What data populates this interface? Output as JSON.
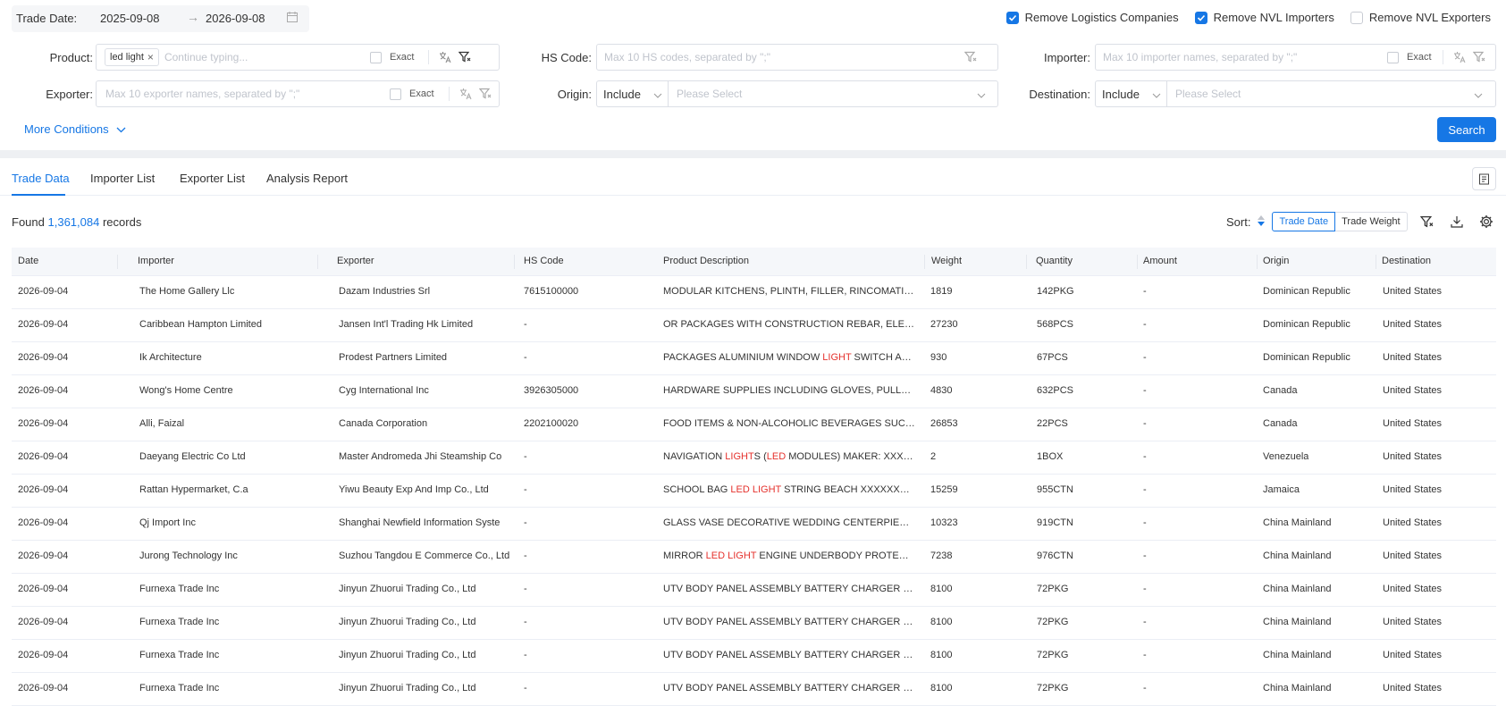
{
  "trade_date": {
    "label": "Trade Date:",
    "from": "2025-09-08",
    "arrow": "→",
    "to": "2026-09-08"
  },
  "checkboxes": [
    {
      "label": "Remove Logistics Companies",
      "checked": true
    },
    {
      "label": "Remove NVL Importers",
      "checked": true
    },
    {
      "label": "Remove NVL Exporters",
      "checked": false
    }
  ],
  "filters": {
    "product": {
      "label": "Product:",
      "tag": "led light",
      "placeholder": "Continue typing...",
      "exact": "Exact"
    },
    "hs_code": {
      "label": "HS Code:",
      "placeholder": "Max 10 HS codes, separated by \";\""
    },
    "importer": {
      "label": "Importer:",
      "placeholder": "Max 10 importer names, separated by \";\"",
      "exact": "Exact"
    },
    "exporter": {
      "label": "Exporter:",
      "placeholder": "Max 10 exporter names, separated by \";\"",
      "exact": "Exact"
    },
    "origin": {
      "label": "Origin:",
      "mode": "Include",
      "placeholder": "Please Select"
    },
    "destination": {
      "label": "Destination:",
      "mode": "Include",
      "placeholder": "Please Select"
    }
  },
  "more_conditions": "More Conditions",
  "search_button": "Search",
  "tabs": [
    "Trade Data",
    "Importer List",
    "Exporter List",
    "Analysis Report"
  ],
  "results": {
    "prefix": "Found",
    "count": "1,361,084",
    "suffix": "records"
  },
  "sort": {
    "label": "Sort:",
    "options": [
      "Trade Date",
      "Trade Weight"
    ],
    "active": "Trade Date"
  },
  "colors": {
    "accent": "#1677e5",
    "highlight": "#e5322d"
  },
  "table": {
    "columns": [
      "Date",
      "Importer",
      "Exporter",
      "HS Code",
      "Product Description",
      "Weight",
      "Quantity",
      "Amount",
      "Origin",
      "Destination"
    ],
    "rows": [
      {
        "date": "2026-09-04",
        "importer": "The Home Gallery Llc",
        "exporter": "Dazam Industries Srl",
        "hs": "7615100000",
        "desc": [
          {
            "t": "MODULAR KITCHENS, PLINTH, FILLER, RINCOMATIC SYMMETRIC, DRAWER"
          }
        ],
        "weight": "1819",
        "qty": "142PKG",
        "amount": "-",
        "origin": "Dominican Republic",
        "dest": "United States"
      },
      {
        "date": "2026-09-04",
        "importer": "Caribbean Hampton Limited",
        "exporter": "Jansen Int'l Trading Hk Limited",
        "hs": "-",
        "desc": [
          {
            "t": "OR PACKAGES WITH CONSTRUCTION REBAR, ELECTRIC CABLE AND FITTINGS"
          }
        ],
        "weight": "27230",
        "qty": "568PCS",
        "amount": "-",
        "origin": "Dominican Republic",
        "dest": "United States"
      },
      {
        "date": "2026-09-04",
        "importer": "Ik Architecture",
        "exporter": "Prodest Partners Limited",
        "hs": "-",
        "desc": [
          {
            "t": "PACKAGES ALUMINIUM WINDOW "
          },
          {
            "t": "LIGHT",
            "h": true
          },
          {
            "t": " SWITCH AND SOCKET FRAMES"
          }
        ],
        "weight": "930",
        "qty": "67PCS",
        "amount": "-",
        "origin": "Dominican Republic",
        "dest": "United States"
      },
      {
        "date": "2026-09-04",
        "importer": "Wong's Home Centre",
        "exporter": "Cyg International Inc",
        "hs": "3926305000",
        "desc": [
          {
            "t": "HARDWARE SUPPLIES INCLUDING GLOVES, PULLS, KNOBS AND HINGES"
          }
        ],
        "weight": "4830",
        "qty": "632PCS",
        "amount": "-",
        "origin": "Canada",
        "dest": "United States"
      },
      {
        "date": "2026-09-04",
        "importer": "Alli, Faizal",
        "exporter": "Canada Corporation",
        "hs": "2202100020",
        "desc": [
          {
            "t": "FOOD ITEMS & NON-ALCOHOLIC BEVERAGES SUCH AS JUICES AND WATER"
          }
        ],
        "weight": "26853",
        "qty": "22PCS",
        "amount": "-",
        "origin": "Canada",
        "dest": "United States"
      },
      {
        "date": "2026-09-04",
        "importer": "Daeyang Electric Co Ltd",
        "exporter": "Master Andromeda Jhi Steamship Co",
        "hs": "-",
        "desc": [
          {
            "t": "NAVIGATION "
          },
          {
            "t": "LIGHT",
            "h": true
          },
          {
            "t": "S ("
          },
          {
            "t": "LED",
            "h": true
          },
          {
            "t": " MODULES) MAKER: XXXXXXXXXX"
          }
        ],
        "weight": "2",
        "qty": "1BOX",
        "amount": "-",
        "origin": "Venezuela",
        "dest": "United States"
      },
      {
        "date": "2026-09-04",
        "importer": "Rattan Hypermarket, C.a",
        "exporter": "Yiwu Beauty Exp And Imp Co., Ltd",
        "hs": "-",
        "desc": [
          {
            "t": "SCHOOL BAG "
          },
          {
            "t": "LED LIGHT",
            "h": true
          },
          {
            "t": " STRING BEACH XXXXXXXX FREIGHT PREPAID"
          }
        ],
        "weight": "15259",
        "qty": "955CTN",
        "amount": "-",
        "origin": "Jamaica",
        "dest": "United States"
      },
      {
        "date": "2026-09-04",
        "importer": "Qj Import Inc",
        "exporter": "Shanghai Newfield Information Syste",
        "hs": "-",
        "desc": [
          {
            "t": "GLASS VASE DECORATIVE WEDDING CENTERPIECE MET AL STAND"
          }
        ],
        "weight": "10323",
        "qty": "919CTN",
        "amount": "-",
        "origin": "China Mainland",
        "dest": "United States"
      },
      {
        "date": "2026-09-04",
        "importer": "Jurong Technology Inc",
        "exporter": "Suzhou Tangdou E Commerce Co., Ltd",
        "hs": "-",
        "desc": [
          {
            "t": "MIRROR "
          },
          {
            "t": "LED LIGHT",
            "h": true
          },
          {
            "t": " ENGINE UNDERBODY PROTECTOR CAR ACCESSORIES"
          }
        ],
        "weight": "7238",
        "qty": "976CTN",
        "amount": "-",
        "origin": "China Mainland",
        "dest": "United States"
      },
      {
        "date": "2026-09-04",
        "importer": "Furnexa Trade Inc",
        "exporter": "Jinyun Zhuorui Trading Co., Ltd",
        "hs": "-",
        "desc": [
          {
            "t": "UTV BODY PANEL ASSEMBLY BATTERY CHARGER FOR E LECTRIC VEHICLE"
          }
        ],
        "weight": "8100",
        "qty": "72PKG",
        "amount": "-",
        "origin": "China Mainland",
        "dest": "United States"
      },
      {
        "date": "2026-09-04",
        "importer": "Furnexa Trade Inc",
        "exporter": "Jinyun Zhuorui Trading Co., Ltd",
        "hs": "-",
        "desc": [
          {
            "t": "UTV BODY PANEL ASSEMBLY BATTERY CHARGER FOR E LECTRIC VEHICLE"
          }
        ],
        "weight": "8100",
        "qty": "72PKG",
        "amount": "-",
        "origin": "China Mainland",
        "dest": "United States"
      },
      {
        "date": "2026-09-04",
        "importer": "Furnexa Trade Inc",
        "exporter": "Jinyun Zhuorui Trading Co., Ltd",
        "hs": "-",
        "desc": [
          {
            "t": "UTV BODY PANEL ASSEMBLY BATTERY CHARGER FOR E LECTRIC VEHICLE"
          }
        ],
        "weight": "8100",
        "qty": "72PKG",
        "amount": "-",
        "origin": "China Mainland",
        "dest": "United States"
      },
      {
        "date": "2026-09-04",
        "importer": "Furnexa Trade Inc",
        "exporter": "Jinyun Zhuorui Trading Co., Ltd",
        "hs": "-",
        "desc": [
          {
            "t": "UTV BODY PANEL ASSEMBLY BATTERY CHARGER FOR E LECTRIC VEHICLE"
          }
        ],
        "weight": "8100",
        "qty": "72PKG",
        "amount": "-",
        "origin": "China Mainland",
        "dest": "United States"
      }
    ]
  }
}
